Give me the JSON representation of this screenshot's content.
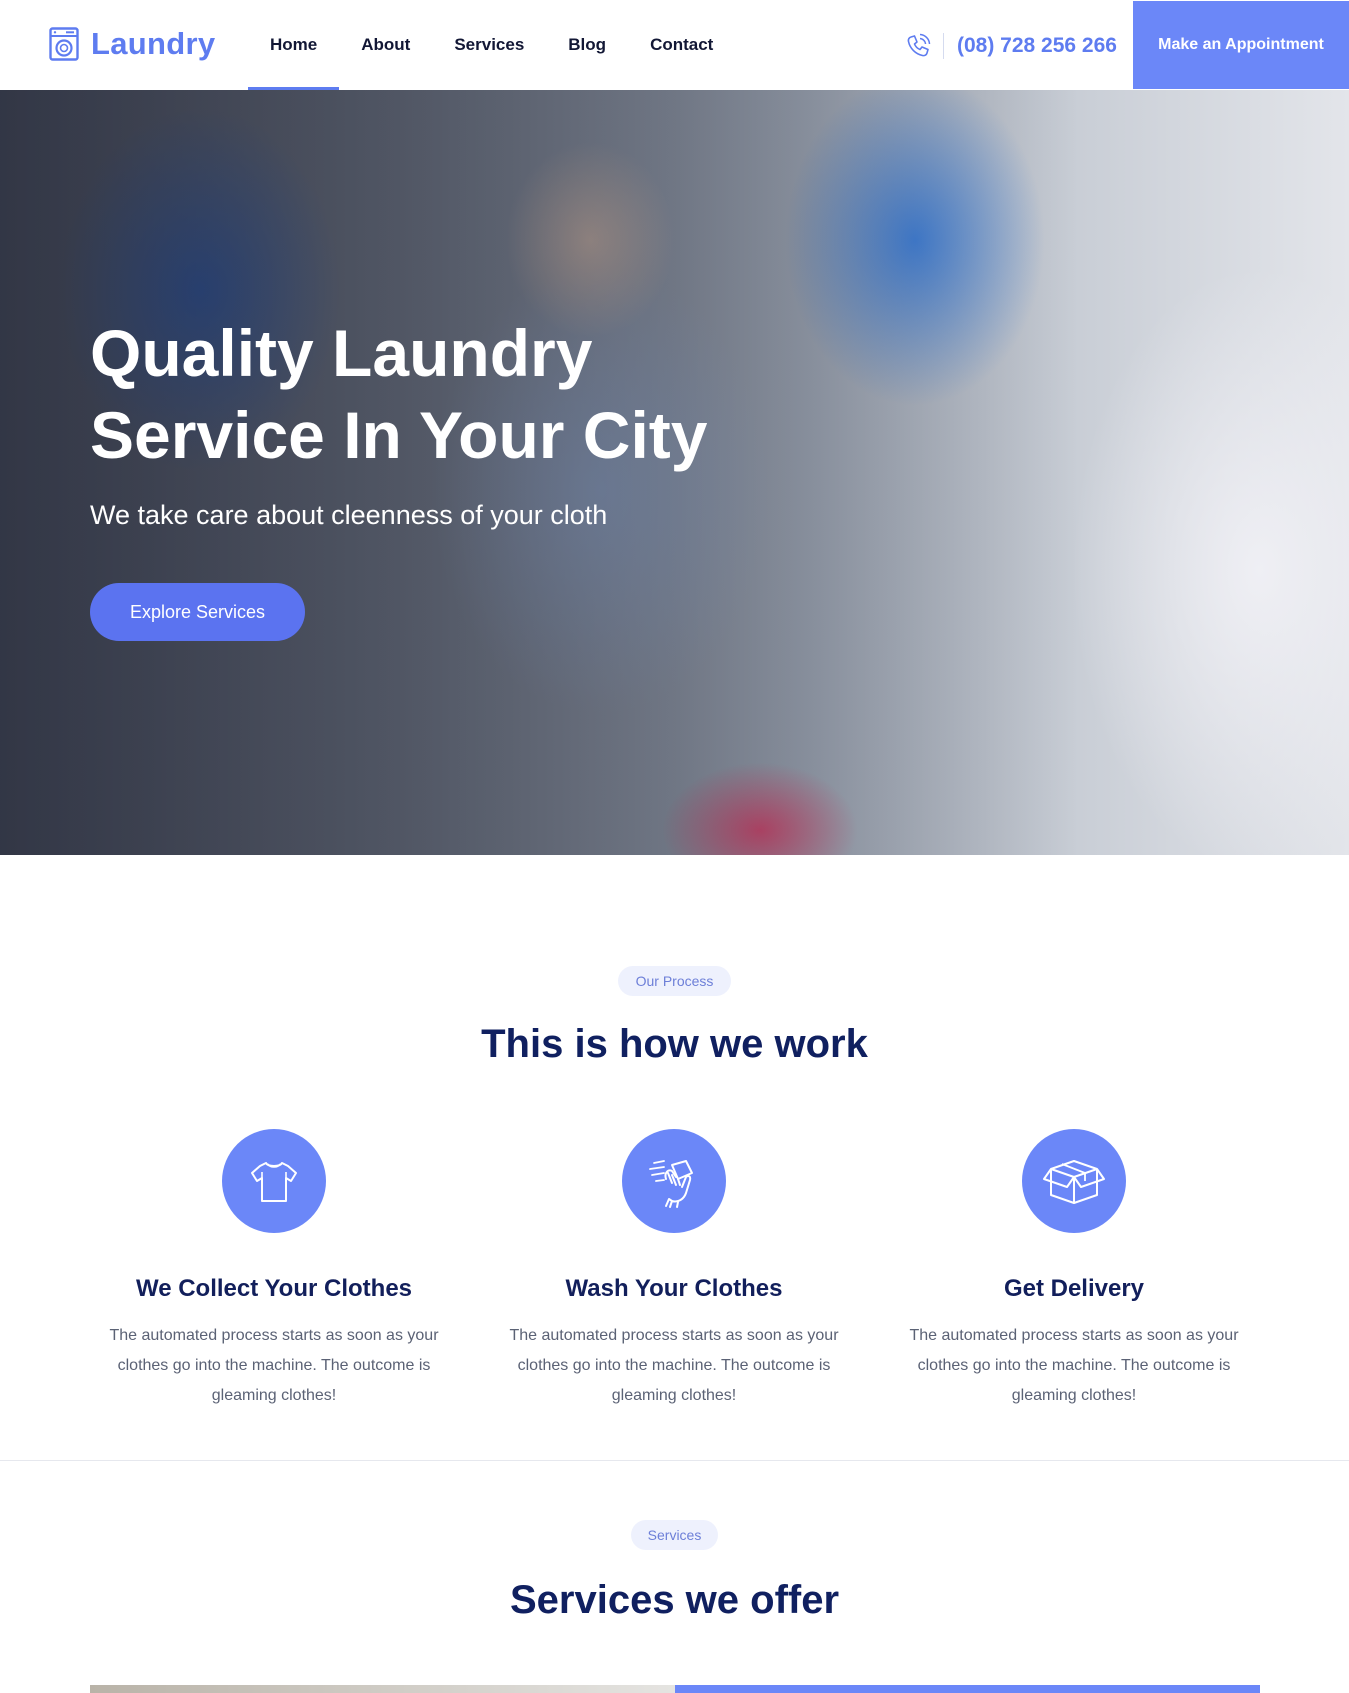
{
  "brand": {
    "name": "Laundry",
    "accent": "#5e7cf0",
    "button": "#6b87f8"
  },
  "nav": {
    "items": [
      {
        "label": "Home",
        "active": true
      },
      {
        "label": "About",
        "active": false
      },
      {
        "label": "Services",
        "active": false
      },
      {
        "label": "Blog",
        "active": false
      },
      {
        "label": "Contact",
        "active": false
      }
    ]
  },
  "header": {
    "phone_icon": "phone-icon",
    "phone": "(08) 728 256 266",
    "appointment_label": "Make an Appointment"
  },
  "hero": {
    "title_line1": "Quality Laundry",
    "title_line2": "Service In Your City",
    "subtitle": "We take care about cleenness of your cloth",
    "cta_label": "Explore Services"
  },
  "process": {
    "tag": "Our Process",
    "title": "This is how we work",
    "steps": [
      {
        "icon": "tshirt-icon",
        "title": "We Collect Your Clothes",
        "text": "The automated process starts as soon as your clothes go into the machine. The outcome is gleaming clothes!"
      },
      {
        "icon": "washing-hand-icon",
        "title": "Wash Your Clothes",
        "text": "The automated process starts as soon as your clothes go into the machine. The outcome is gleaming clothes!"
      },
      {
        "icon": "box-icon",
        "title": "Get Delivery",
        "text": "The automated process starts as soon as your clothes go into the machine. The outcome is gleaming clothes!"
      }
    ]
  },
  "services": {
    "tag": "Services",
    "title": "Services we offer"
  }
}
